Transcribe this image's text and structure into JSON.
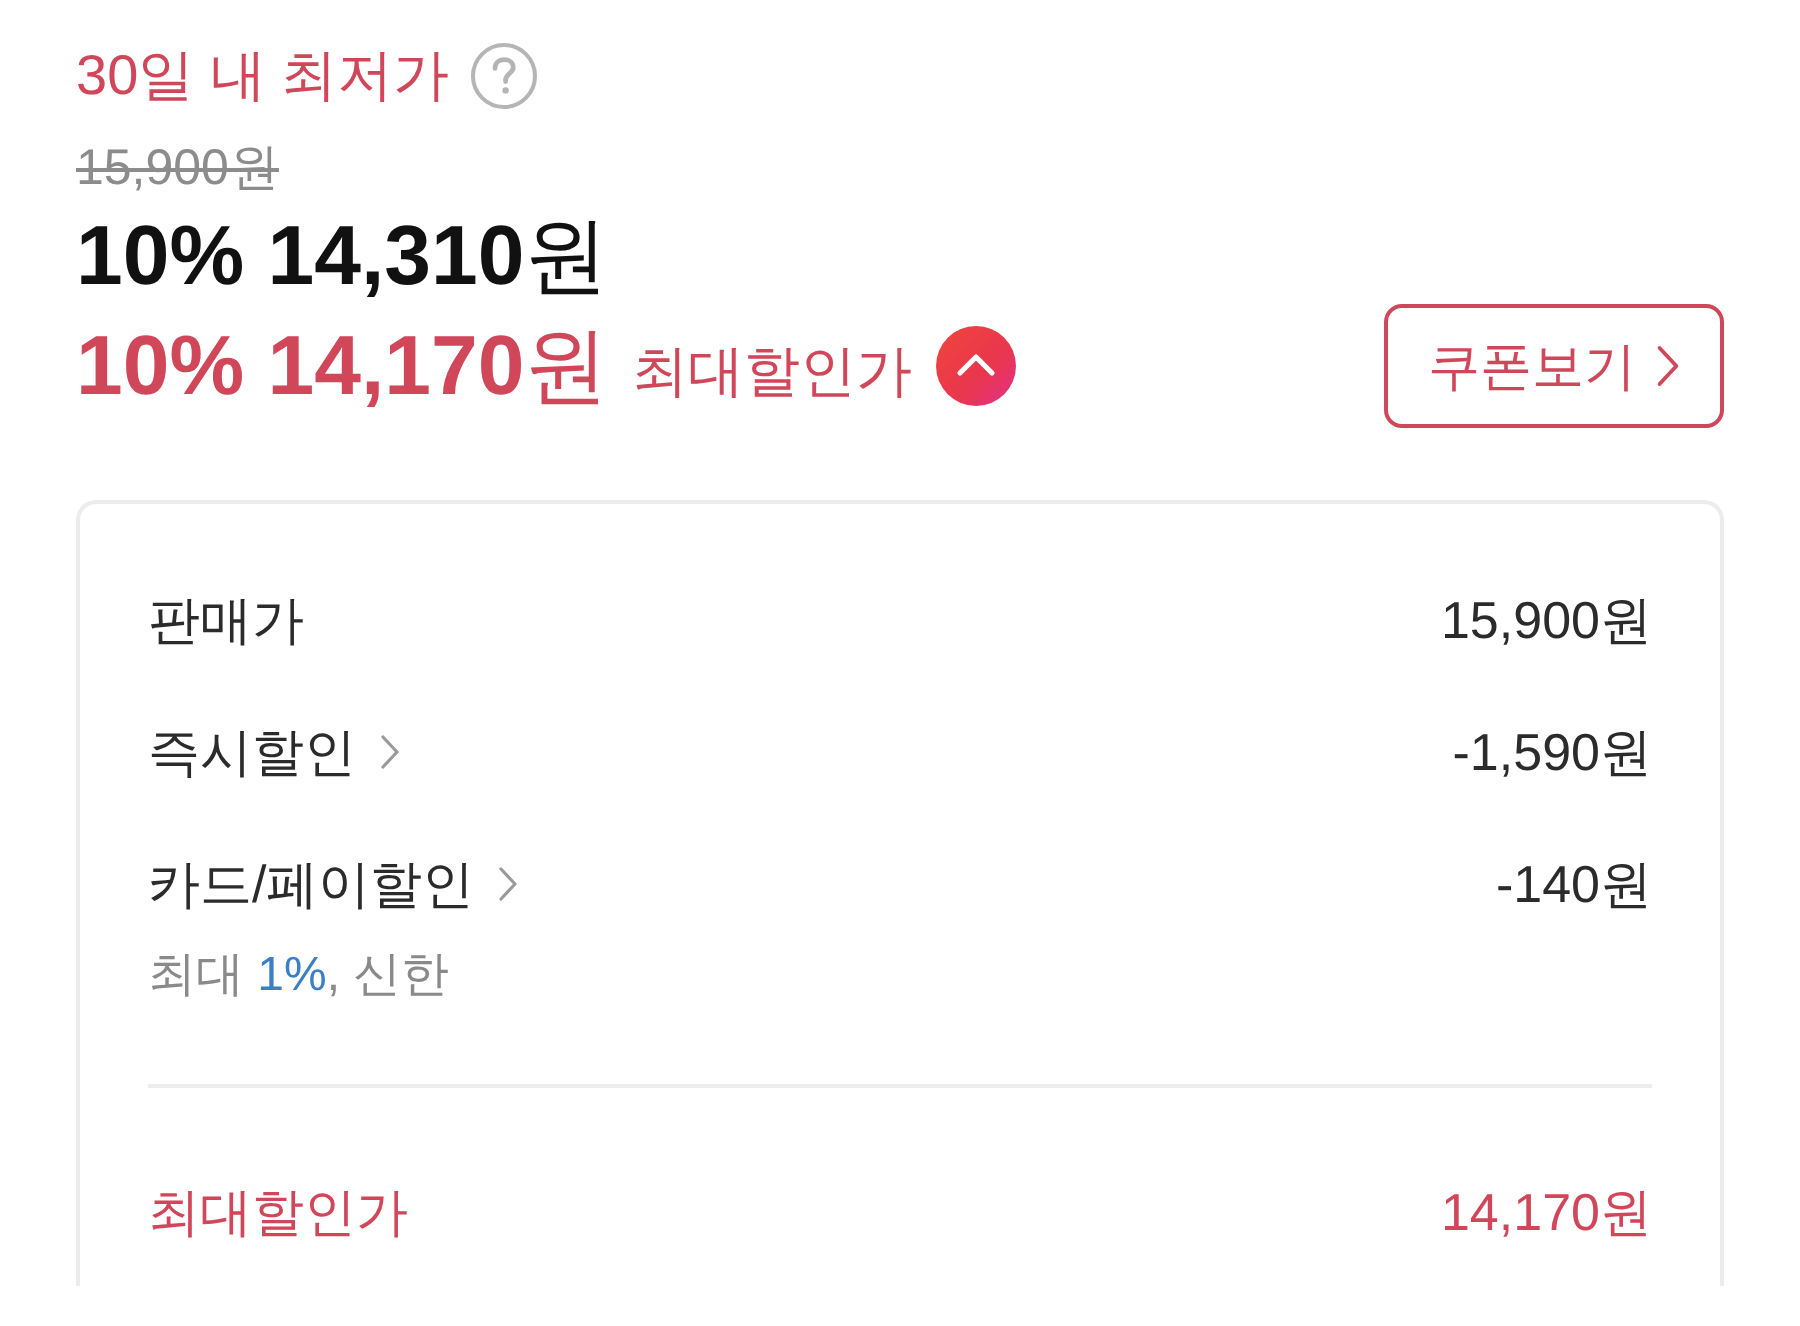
{
  "lowest_price_badge": {
    "label": "30일 내 최저가"
  },
  "original_price": "15,900원",
  "sale_price": {
    "percent": "10%",
    "amount": "14,310",
    "unit": "원"
  },
  "max_discount_price": {
    "percent": "10%",
    "amount": "14,170",
    "unit": "원",
    "label": "최대할인가",
    "expanded": true
  },
  "coupon_button": {
    "label": "쿠폰보기"
  },
  "breakdown": {
    "rows": [
      {
        "label": "판매가",
        "value": "15,900원",
        "link": false
      },
      {
        "label": "즉시할인",
        "value": "-1,590원",
        "link": true
      },
      {
        "label": "카드/페이할인",
        "value": "-140원",
        "link": true,
        "note": {
          "prefix": "최대 ",
          "highlight": "1%",
          "suffix": ", 신한"
        }
      }
    ],
    "total": {
      "label": "최대할인가",
      "value": "14,170원"
    }
  }
}
